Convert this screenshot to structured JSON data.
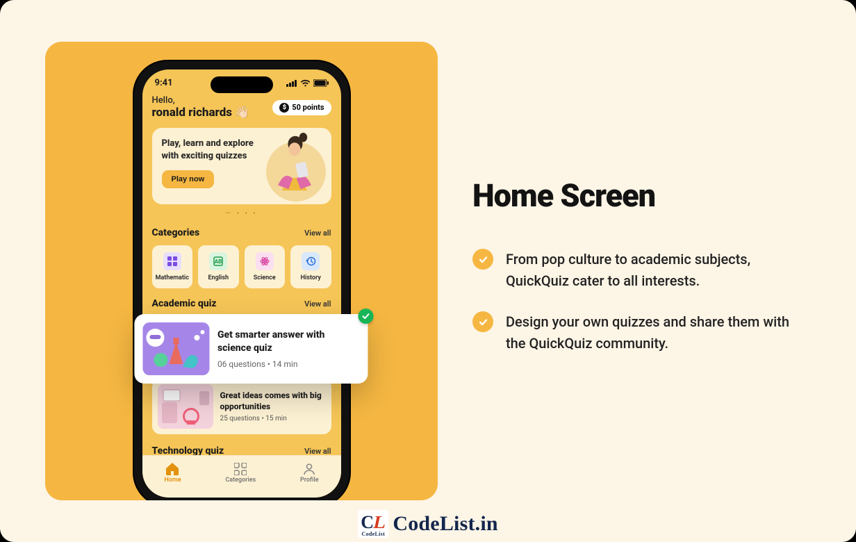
{
  "phone": {
    "status_time": "9:41",
    "greeting": "Hello,",
    "username": "ronald richards",
    "wave_emoji": "👋🏻",
    "points_label": "50 points",
    "hero": {
      "title": "Play, learn and explore with exciting quizzes",
      "cta": "Play now"
    },
    "sections": {
      "categories": {
        "title": "Categories",
        "view_all": "View all",
        "items": [
          {
            "label": "Mathematic"
          },
          {
            "label": "English"
          },
          {
            "label": "Science"
          },
          {
            "label": "History"
          }
        ]
      },
      "academic": {
        "title": "Academic quiz",
        "view_all": "View all"
      },
      "featured_quiz": {
        "title": "Get smarter answer with science quiz",
        "meta": "06 questions • 14 min"
      },
      "quiz2": {
        "title": "Great ideas comes with big opportunities",
        "meta": "25 questions • 15 min"
      },
      "technology": {
        "title": "Technology quiz",
        "view_all": "View all"
      }
    },
    "nav": {
      "home": "Home",
      "categories": "Categories",
      "profile": "Profile"
    }
  },
  "right": {
    "headline": "Home Screen",
    "bullets": [
      "From pop culture to academic subjects, QuickQuiz cater to all interests.",
      "Design your own quizzes and share them with the QuickQuiz community."
    ]
  },
  "watermark": {
    "text": "CodeList.in",
    "sub": "CodeList"
  }
}
